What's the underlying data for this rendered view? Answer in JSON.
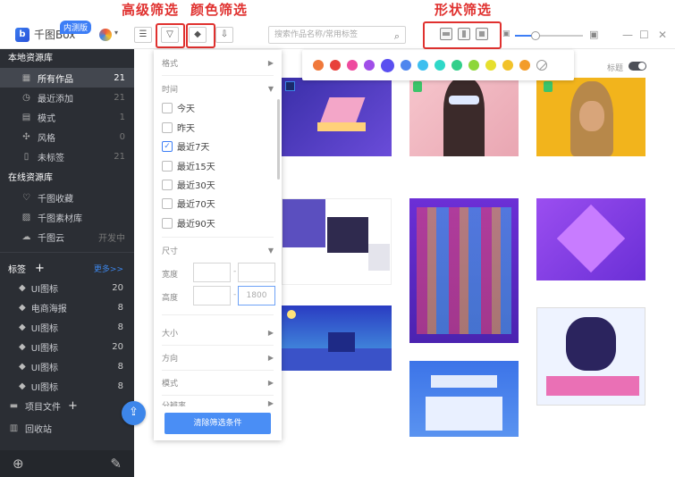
{
  "annotations": {
    "advanced_filter": "高级筛选",
    "color_filter": "颜色筛选",
    "shape_filter": "形状筛选"
  },
  "app": {
    "logo_text": "千图Box",
    "beta_badge": "内测版"
  },
  "search": {
    "placeholder": "搜索作品名称/常用标签"
  },
  "sidebar": {
    "local_header": "本地资源库",
    "local_items": [
      {
        "icon": "grid-icon",
        "label": "所有作品",
        "count": "21"
      },
      {
        "icon": "clock-icon",
        "label": "最近添加",
        "count": "21"
      },
      {
        "icon": "template-icon",
        "label": "模式",
        "count": "1"
      },
      {
        "icon": "style-icon",
        "label": "风格",
        "count": "0"
      },
      {
        "icon": "untagged-icon",
        "label": "未标签",
        "count": "21"
      }
    ],
    "online_header": "在线资源库",
    "online_items": [
      {
        "icon": "heart-icon",
        "label": "千图收藏",
        "count": ""
      },
      {
        "icon": "image-icon",
        "label": "千图素材库",
        "count": ""
      },
      {
        "icon": "cloud-icon",
        "label": "千图云",
        "count": "开发中"
      }
    ],
    "tags_header": "标签",
    "tags_more": "更多>>",
    "tags": [
      {
        "label": "UI图标",
        "count": "20"
      },
      {
        "label": "电商海报",
        "count": "8"
      },
      {
        "label": "UI图标",
        "count": "8"
      },
      {
        "label": "UI图标",
        "count": "20"
      },
      {
        "label": "UI图标",
        "count": "8"
      },
      {
        "label": "UI图标",
        "count": "8"
      }
    ],
    "project_files": "项目文件",
    "recycle_bin": "回收站"
  },
  "filter_panel": {
    "format_label": "格式",
    "time_label": "时间",
    "time_options": [
      {
        "label": "今天",
        "checked": false
      },
      {
        "label": "昨天",
        "checked": false
      },
      {
        "label": "最近7天",
        "checked": true
      },
      {
        "label": "最近15天",
        "checked": false
      },
      {
        "label": "最近30天",
        "checked": false
      },
      {
        "label": "最近70天",
        "checked": false
      },
      {
        "label": "最近90天",
        "checked": false
      }
    ],
    "size_label": "尺寸",
    "width_label": "宽度",
    "height_label": "高度",
    "height_max": "1800",
    "range_sep": "-",
    "size_kind_label": "大小",
    "orientation_label": "方向",
    "mode_label": "模式",
    "resolution_label": "分辨率",
    "clear_button": "清除筛选条件",
    "check_mark": "✓"
  },
  "toolbar": {
    "title_toggle_label": "标题"
  },
  "colors": {
    "accent": "#3d7ef6",
    "annotation": "#e0312f",
    "palette": [
      "#f0783a",
      "#e8413b",
      "#ee4a9e",
      "#a04ee8",
      "#5a4ff0",
      "#4e86ee",
      "#3dbfef",
      "#2fd8c8",
      "#32cf8a",
      "#8dd63a",
      "#e6df2e",
      "#f2c22a",
      "#f39c2a"
    ]
  }
}
